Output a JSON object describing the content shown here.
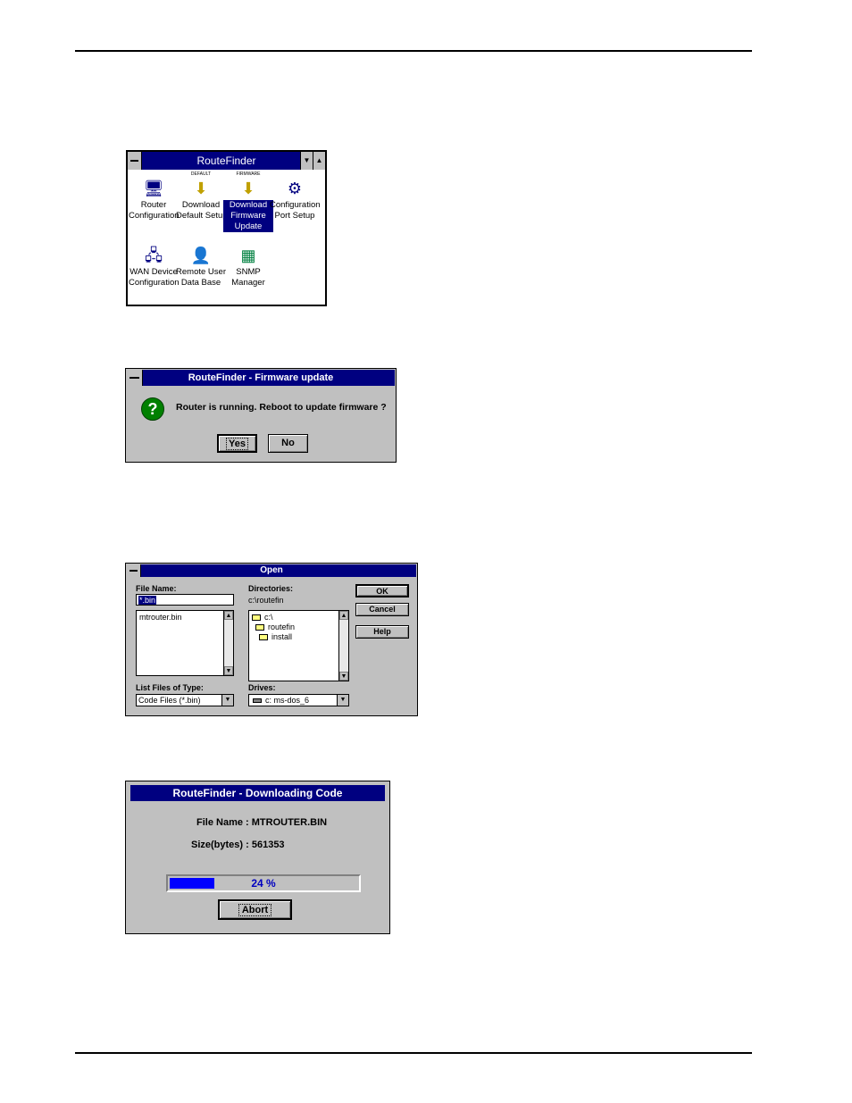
{
  "routefinder_group": {
    "title": "RouteFinder",
    "icons": [
      {
        "top": "",
        "lines": [
          "Router",
          "Configuration"
        ],
        "selected": false,
        "icon": "router-icon"
      },
      {
        "top": "DEFAULT",
        "lines": [
          "Download",
          "Default Setup"
        ],
        "selected": false,
        "icon": "download-default-icon"
      },
      {
        "top": "FIRMWARE",
        "lines": [
          "Download",
          "Firmware",
          "Update"
        ],
        "selected": true,
        "icon": "download-firmware-icon"
      },
      {
        "top": "",
        "lines": [
          "Configuration",
          "Port Setup"
        ],
        "selected": false,
        "icon": "port-setup-icon"
      },
      {
        "top": "",
        "lines": [
          "WAN Device",
          "Configuration"
        ],
        "selected": false,
        "icon": "wan-device-icon"
      },
      {
        "top": "",
        "lines": [
          "Remote User",
          "Data Base"
        ],
        "selected": false,
        "icon": "remote-user-icon"
      },
      {
        "top": "",
        "lines": [
          "SNMP",
          "Manager"
        ],
        "selected": false,
        "icon": "snmp-manager-icon"
      }
    ]
  },
  "firmware_dialog": {
    "title": "RouteFinder - Firmware update",
    "message": "Router is running. Reboot to update firmware ?",
    "yes_label": "Yes",
    "no_label": "No"
  },
  "open_dialog": {
    "title": "Open",
    "file_name_label": "File Name:",
    "file_name_value": "*.bin",
    "files": [
      "mtrouter.bin"
    ],
    "directories_label": "Directories:",
    "current_dir": "c:\\routefin",
    "dir_tree": [
      "c:\\",
      "routefin",
      "install"
    ],
    "file_type_label": "List Files of Type:",
    "file_type_value": "Code Files (*.bin)",
    "drives_label": "Drives:",
    "drive_value": "c: ms-dos_6",
    "ok_label": "OK",
    "cancel_label": "Cancel",
    "help_label": "Help"
  },
  "download_dialog": {
    "title": "RouteFinder - Downloading Code",
    "file_name_line": "File Name : MTROUTER.BIN",
    "size_line": "Size(bytes) : 561353",
    "progress_text": "24 %",
    "progress_fraction": 0.24,
    "abort_label": "Abort"
  },
  "colors": {
    "titlebar": "#000080",
    "face": "#c0c0c0",
    "progress_fill": "#0000ff",
    "progress_text": "#0000c0"
  }
}
